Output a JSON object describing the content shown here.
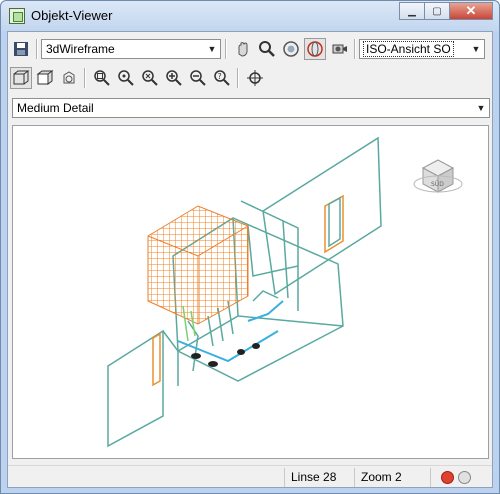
{
  "window": {
    "title": "Objekt-Viewer"
  },
  "toolbar": {
    "visual_style": "3dWireframe",
    "view": "ISO-Ansicht SO"
  },
  "detail": {
    "level": "Medium Detail"
  },
  "viewcube": {
    "label": "SÜD"
  },
  "status": {
    "lines": "Linse 28",
    "zoom": "Zoom 2"
  },
  "colors": {
    "accent_red": "#e04030",
    "wire_cyan": "#5aa9a0",
    "wire_orange": "#f08020"
  }
}
